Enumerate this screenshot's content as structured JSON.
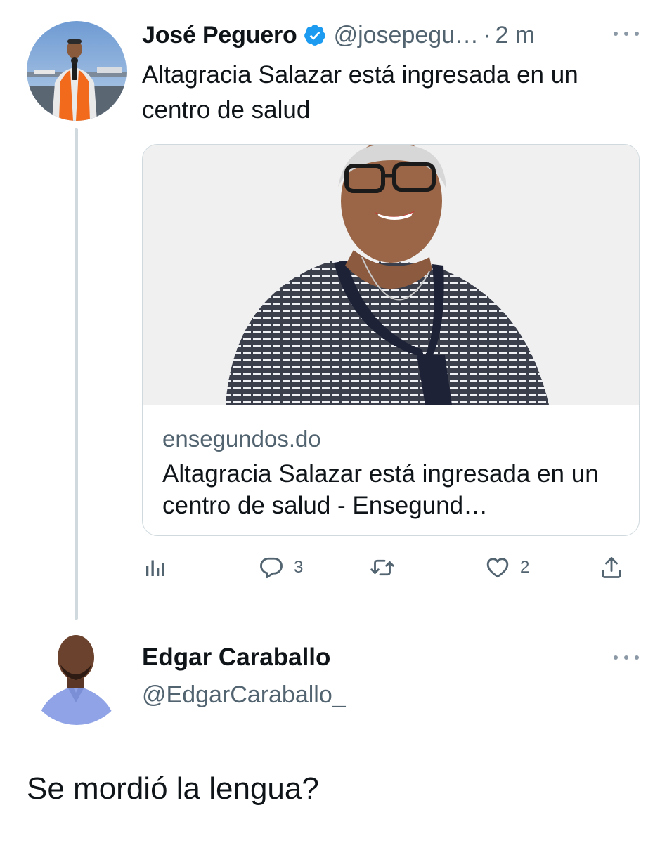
{
  "tweet": {
    "author_name": "José Peguero",
    "author_handle": "@josepegu…",
    "separator": "·",
    "time": "2 m",
    "text": "Altagracia Salazar está ingresada en un centro de salud",
    "card": {
      "domain": "ensegundos.do",
      "title": "Altagracia Salazar está ingresada en un centro de salud - Ensegund…"
    },
    "actions": {
      "replies": "3",
      "likes": "2"
    }
  },
  "reply": {
    "author_name": "Edgar Caraballo",
    "author_handle": "@EdgarCaraballo_",
    "text": "Se mordió la lengua?"
  },
  "colors": {
    "verified": "#1d9bf0",
    "secondary_text": "#536471",
    "icon": "#536471",
    "border": "#cfd9de"
  }
}
